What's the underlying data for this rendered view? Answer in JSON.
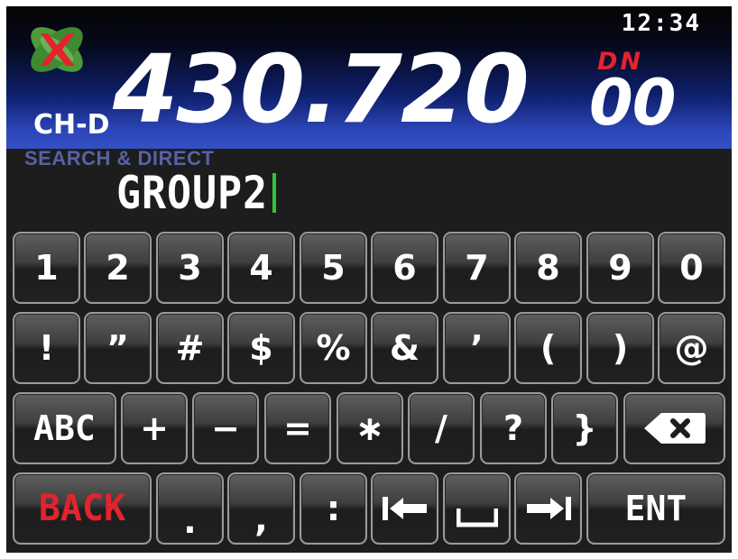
{
  "status": {
    "clock": "12:34"
  },
  "header": {
    "logo_icon": "radio-brand-logo",
    "frequency_main": "430.720",
    "frequency_sub": "00",
    "mode_indicator": "DN",
    "channel_label": "CH-D"
  },
  "search": {
    "mode_title": "SEARCH & DIRECT",
    "input_value": "GROUP2"
  },
  "colors": {
    "accent_red": "#e3232e",
    "cursor_green": "#35c33c",
    "title_purple": "#5961a6"
  },
  "keyboard": {
    "row_digits": [
      "1",
      "2",
      "3",
      "4",
      "5",
      "6",
      "7",
      "8",
      "9",
      "0"
    ],
    "row_symbols": [
      "!",
      "”",
      "#",
      "$",
      "%",
      "&",
      "’",
      "(",
      ")",
      "@"
    ],
    "row_ops": {
      "abc_label": "ABC",
      "keys": [
        "+",
        "−",
        "=",
        "∗",
        "/",
        "?",
        "}"
      ],
      "backspace_icon": "backspace-icon"
    },
    "row_bottom": {
      "back_label": "BACK",
      "period": ".",
      "comma": ",",
      "colon": ":",
      "cursor_left_icon": "cursor-left-icon",
      "space_icon": "space-icon",
      "cursor_right_icon": "cursor-right-icon",
      "ent_label": "ENT"
    }
  }
}
